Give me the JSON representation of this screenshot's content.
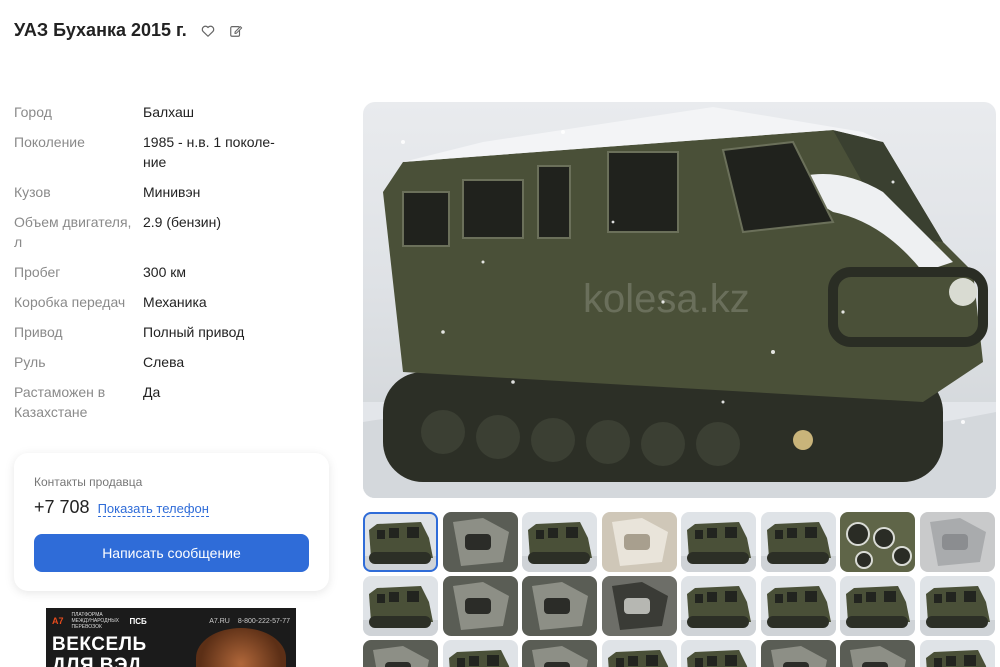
{
  "listing": {
    "title": "УАЗ Буханка 2015 г.",
    "favorite_icon": "heart-icon",
    "edit_icon": "edit-note-icon"
  },
  "specs": [
    {
      "label": "Город",
      "value": "Балхаш"
    },
    {
      "label": "Поколение",
      "value": "1985 - н.в. 1 поколе-\nние"
    },
    {
      "label": "Кузов",
      "value": "Минивэн"
    },
    {
      "label": "Объем двигателя, л",
      "value": "2.9 (бензин)"
    },
    {
      "label": "Пробег",
      "value": "300 км"
    },
    {
      "label": "Коробка передач",
      "value": "Механика"
    },
    {
      "label": "Привод",
      "value": "Полный привод"
    },
    {
      "label": "Руль",
      "value": "Слева"
    },
    {
      "label": "Растаможен в Казахстане",
      "value": "Да"
    }
  ],
  "contacts": {
    "label": "Контакты продавца",
    "phone": "+7 708",
    "show_phone": "Показать телефон",
    "message_button": "Написать сообщение"
  },
  "ad": {
    "logo": "A7",
    "tagline": "ПЛАТФОРМА МЕЖДУНАРОДНЫХ ПЕРЕВОЗОК",
    "bank": "ПСБ",
    "site": "A7.RU",
    "phone": "8-800-222-57-77",
    "headline_1": "ВЕКСЕЛЬ",
    "headline_2": "ДЛЯ ВЭД"
  },
  "photo": {
    "watermark": "kolesa.kz"
  },
  "colors": {
    "accent": "#2f6cd8",
    "vehicle": "#4a5038",
    "snow": "#f3f4f6"
  },
  "thumbnails": [
    {
      "kind": "exterior",
      "active": true
    },
    {
      "kind": "engine"
    },
    {
      "kind": "exterior"
    },
    {
      "kind": "interior-light"
    },
    {
      "kind": "exterior"
    },
    {
      "kind": "exterior"
    },
    {
      "kind": "gauges"
    },
    {
      "kind": "interior-grey"
    },
    {
      "kind": "exterior"
    },
    {
      "kind": "engine"
    },
    {
      "kind": "engine"
    },
    {
      "kind": "tracks"
    },
    {
      "kind": "exterior"
    },
    {
      "kind": "exterior"
    },
    {
      "kind": "exterior"
    },
    {
      "kind": "exterior"
    },
    {
      "kind": "engine"
    },
    {
      "kind": "exterior"
    },
    {
      "kind": "engine"
    },
    {
      "kind": "exterior"
    },
    {
      "kind": "exterior"
    },
    {
      "kind": "engine"
    },
    {
      "kind": "engine"
    },
    {
      "kind": "exterior"
    }
  ]
}
